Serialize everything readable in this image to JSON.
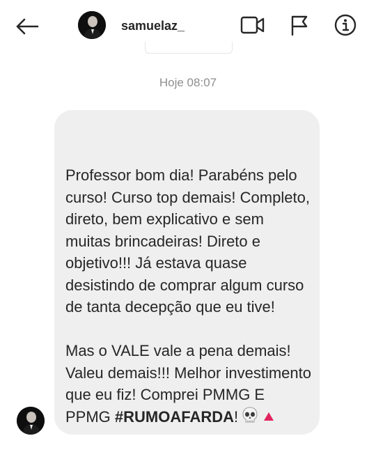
{
  "header": {
    "username": "samuelaz_",
    "back_icon": "arrow-left-icon",
    "video_icon": "video-camera-icon",
    "flag_icon": "flag-icon",
    "info_icon": "info-icon"
  },
  "thread": {
    "timestamp": "Hoje 08:07",
    "message": {
      "paragraph1": "Professor bom dia! Parabéns pelo curso! Curso top demais! Completo, direto, bem explicativo e sem muitas brincadeiras! Direto e objetivo!!! Já estava quase desistindo de comprar algum curso de tanta decepção que eu tive!",
      "paragraph2": "Mas o VALE vale a pena demais! Valeu demais!!! Melhor investimento que eu fiz! Comprei PMMG E PPMG ",
      "hashtag": "#RUMOAFARDA",
      "after_hashtag": "!",
      "emojis": [
        "skull-emoji",
        "red-triangle-emoji"
      ]
    }
  },
  "colors": {
    "bubble_bg": "#efefef",
    "text": "#262626",
    "timestamp": "#8e8e8e",
    "accent_red": "#e0245e"
  }
}
